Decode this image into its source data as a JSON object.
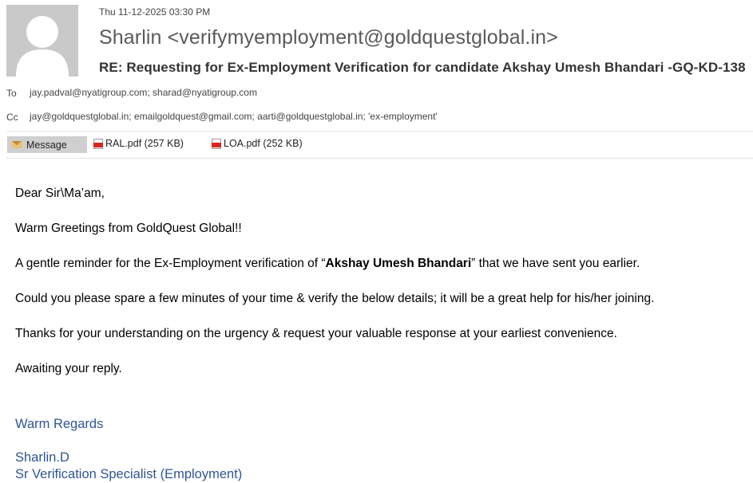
{
  "email": {
    "date": "Thu 11-12-2025 03:30 PM",
    "from": "Sharlin <verifymyemployment@goldquestglobal.in>",
    "subject": "RE: Requesting for Ex-Employment Verification for candidate Akshay Umesh Bhandari -GQ-KD-138",
    "to_label": "To",
    "to": "jay.padval@nyatigroup.com; sharad@nyatigroup.com",
    "cc_label": "Cc",
    "cc": "jay@goldquestglobal.in; emailgoldquest@gmail.com; aarti@goldquestglobal.in; 'ex-employment'"
  },
  "attachments_bar": {
    "message_tab": "Message",
    "attachments": [
      {
        "name": "RAL.pdf (257 KB)",
        "icon": "pdf-icon"
      },
      {
        "name": "LOA.pdf (252 KB)",
        "icon": "pdf-icon"
      }
    ]
  },
  "body": {
    "greeting": "Dear Sir\\Ma’am,",
    "line1": "Warm Greetings from GoldQuest Global!!",
    "line2_pre": "A gentle reminder for the Ex-Employment verification of “",
    "line2_bold": "Akshay Umesh Bhandari",
    "line2_post": "” that we have sent you earlier.",
    "line3": "Could you please spare a few minutes of your time & verify the below details; it will be a great  help for his/her joining.",
    "line4": "Thanks for your understanding on the urgency & request your valuable response at your earliest convenience.",
    "line5": "Awaiting your reply."
  },
  "signature": {
    "regards": "Warm Regards",
    "name": "Sharlin.D",
    "title": "Sr Verification Specialist (Employment)"
  },
  "colors": {
    "signature": "#2f5496",
    "message_tab": "#cfcfcf",
    "avatar_bg": "#c9c9c9"
  }
}
